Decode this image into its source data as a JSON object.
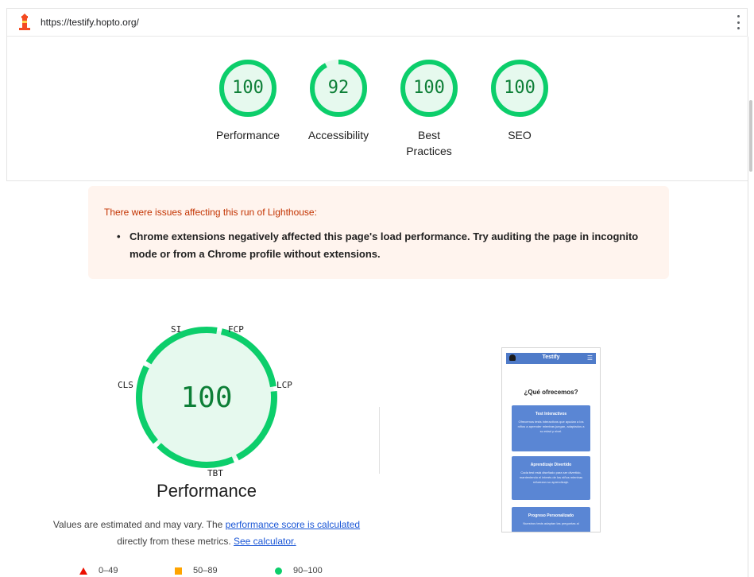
{
  "header": {
    "url": "https://testify.hopto.org/"
  },
  "categories": [
    {
      "label": "Performance",
      "score": "100",
      "fraction": 1.0
    },
    {
      "label": "Accessibility",
      "score": "92",
      "fraction": 0.92
    },
    {
      "label": "Best Practices",
      "score": "100",
      "fraction": 1.0
    },
    {
      "label": "SEO",
      "score": "100",
      "fraction": 1.0
    }
  ],
  "warning": {
    "title": "There were issues affecting this run of Lighthouse:",
    "items": [
      "Chrome extensions negatively affected this page's load performance. Try auditing the page in incognito mode or from a Chrome profile without extensions."
    ]
  },
  "performance": {
    "score": "100",
    "title": "Performance",
    "metrics": [
      "SI",
      "FCP",
      "LCP",
      "TBT",
      "CLS"
    ],
    "note_prefix": "Values are estimated and may vary. The ",
    "note_link": "performance score is calculated",
    "note_middle": " directly from these metrics. ",
    "note_link2": "See calculator."
  },
  "legend": [
    {
      "range": "0–49",
      "shape": "triangle",
      "color": "#eb0f00"
    },
    {
      "range": "50–89",
      "shape": "square",
      "color": "#ffa400"
    },
    {
      "range": "90–100",
      "shape": "circle",
      "color": "#0cce6b"
    }
  ],
  "screenshot": {
    "brand": "Testify",
    "heading": "¿Qué ofrecemos?",
    "cards": [
      {
        "title": "Test Interactivos",
        "text": "Ofrecemos tests interactivos que ayudan a los niños a aprender mientras juegan, adaptados a su edad y nivel."
      },
      {
        "title": "Aprendizaje Divertido",
        "text": "Cada test está diseñado para ser divertido, manteniendo el interés de los niños mientras refuerzan su aprendizaje."
      },
      {
        "title": "Progreso Personalizado",
        "text": "Nuestros tests adaptan las preguntas al"
      }
    ]
  },
  "colors": {
    "pass": "#0cce6b",
    "pass_text": "#0d7f37",
    "pass_fill": "#e6f9ee",
    "warn_bg": "#fff4ee",
    "link": "#1a56d6"
  }
}
